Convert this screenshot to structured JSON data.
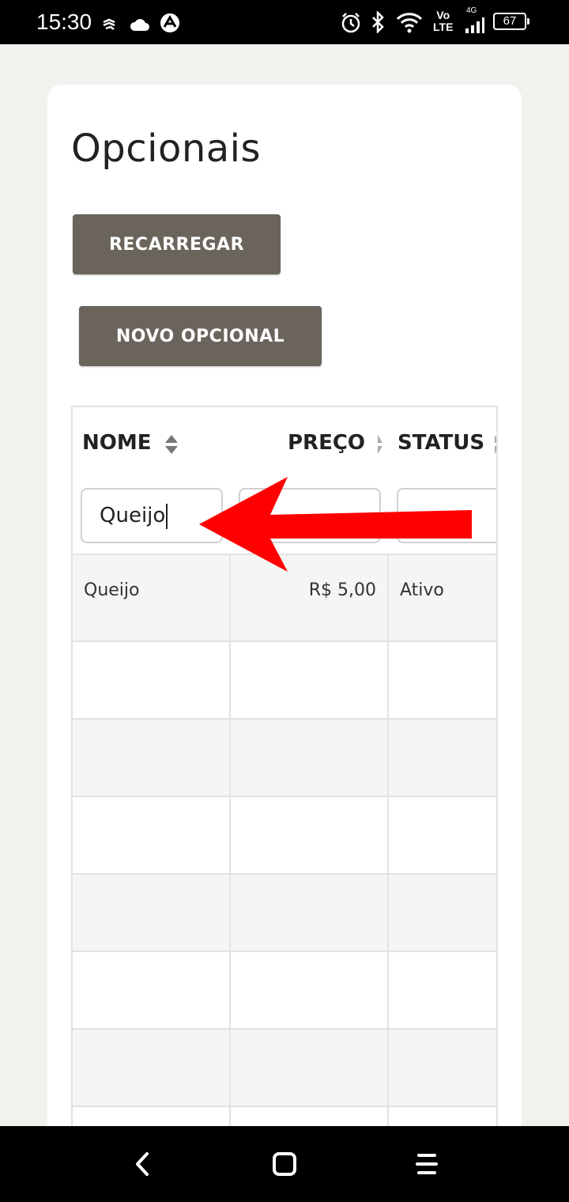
{
  "status_bar": {
    "time": "15:30",
    "network_label_top": "Vo",
    "network_label_bottom": "LTE",
    "network_type": "4G",
    "battery": "67",
    "icons": [
      "sync-icon",
      "cloud-icon",
      "app-icon",
      "alarm-icon",
      "bluetooth-icon",
      "wifi-icon",
      "signal-icon",
      "battery-icon"
    ]
  },
  "page": {
    "title": "Opcionais"
  },
  "buttons": {
    "reload_label": "RECARREGAR",
    "new_label": "NOVO OPCIONAL"
  },
  "table": {
    "columns": [
      {
        "label": "NOME"
      },
      {
        "label": "PREÇO"
      },
      {
        "label": "STATUS"
      }
    ],
    "filters": {
      "nome": "Queijo",
      "preco": "",
      "status": ""
    },
    "rows": [
      {
        "nome": "Queijo",
        "preco": "R$ 5,00",
        "status": "Ativo"
      }
    ]
  },
  "colors": {
    "button_bg": "#6a645c",
    "arrow": "#ff0000",
    "page_bg": "#f2f1ee"
  }
}
